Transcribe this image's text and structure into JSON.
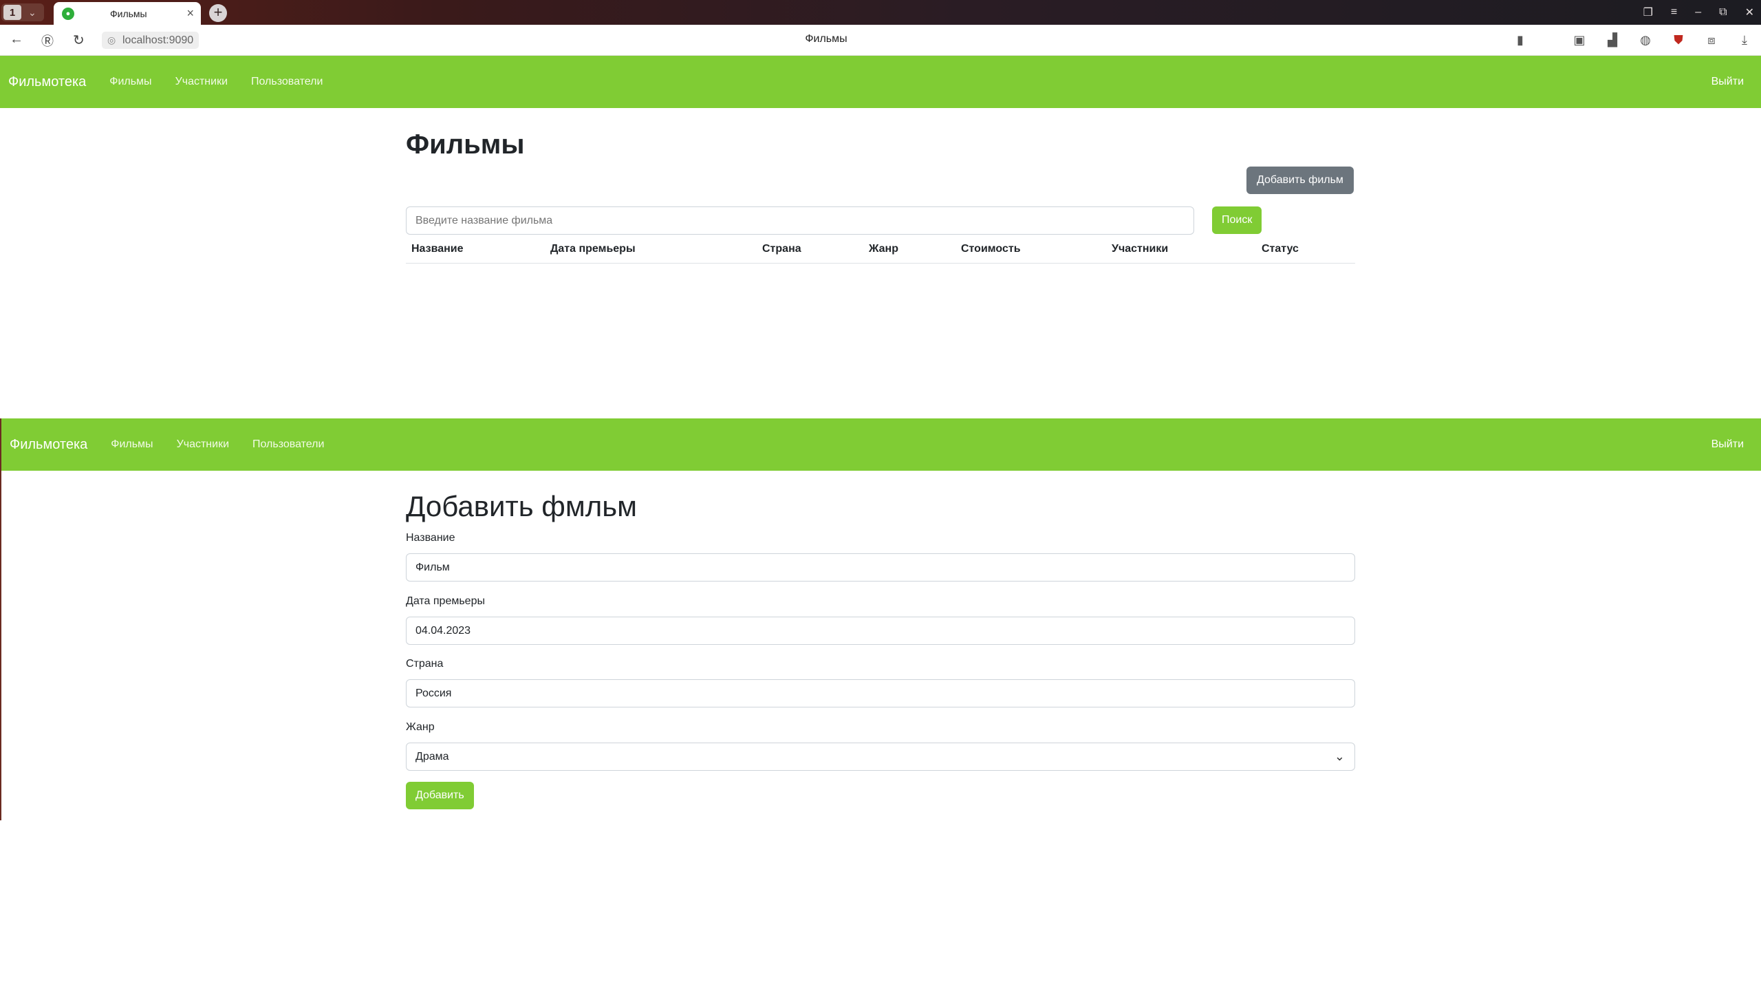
{
  "browser": {
    "tab_counter": "1",
    "tab_title": "Фильмы",
    "url": "localhost:9090",
    "page_title": "Фильмы"
  },
  "nav_top": {
    "brand": "Фильмотека",
    "links": [
      "Фильмы",
      "Участники",
      "Пользователи"
    ],
    "logout": "Выйти"
  },
  "films_page": {
    "title": "Фильмы",
    "add_button": "Добавить фильм",
    "search_placeholder": "Введите название фильма",
    "search_button": "Поиск",
    "columns": [
      "Название",
      "Дата премьеры",
      "Страна",
      "Жанр",
      "Стоимость",
      "Участники",
      "Статус"
    ]
  },
  "nav_bottom": {
    "brand": "Фильмотека",
    "links": [
      "Фильмы",
      "Участники",
      "Пользователи"
    ],
    "logout": "Выйти"
  },
  "add_page": {
    "title": "Добавить фмльм",
    "fields": [
      {
        "label": "Название",
        "value": "Фильм"
      },
      {
        "label": "Дата премьеры",
        "value": "04.04.2023"
      },
      {
        "label": "Страна",
        "value": "Россия"
      },
      {
        "label": "Жанр",
        "value": "Драма"
      }
    ],
    "submit": "Добавить"
  },
  "colors": {
    "nav_green": "#80cc34",
    "button_grey": "#6c757d"
  }
}
